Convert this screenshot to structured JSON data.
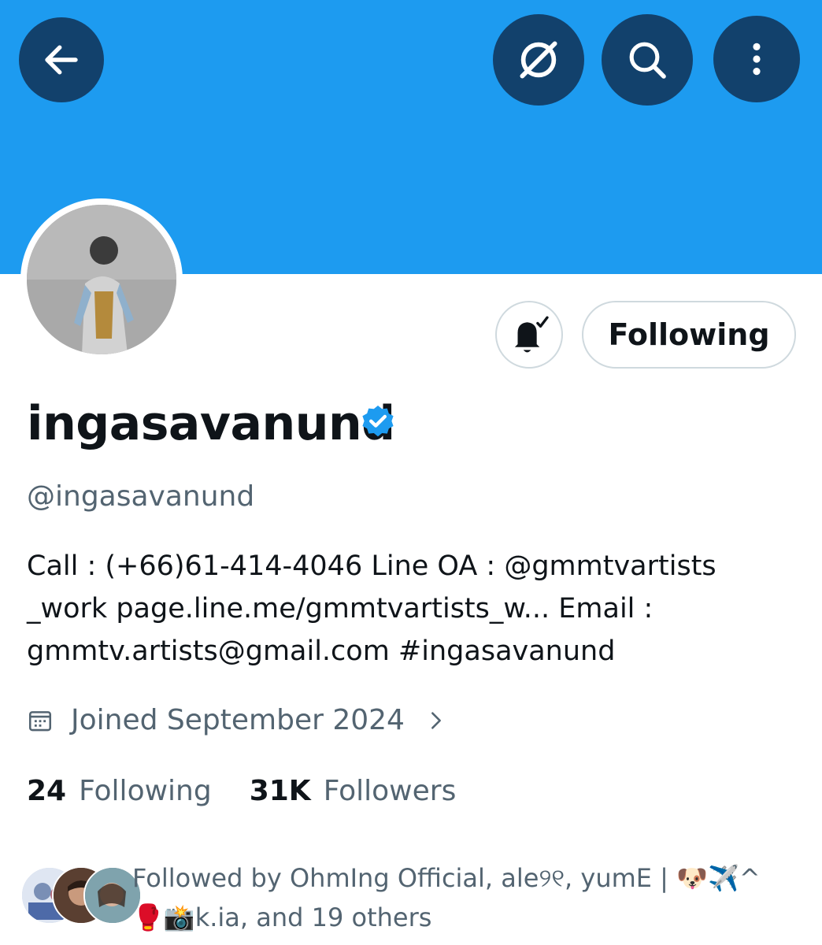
{
  "header": {
    "back_icon": "arrow-left-icon",
    "grok_icon": "grok-icon",
    "search_icon": "search-icon",
    "more_icon": "more-vertical-icon"
  },
  "profile": {
    "display_name": "ingasavanund",
    "handle": "@ingasavanund",
    "verified": true,
    "bio_lines": [
      "Call : (+66)61-414-4046  Line OA : @gmmtvartists",
      "_work page.line.me/gmmtvartists_w... Email :",
      "gmmtv.artists@gmail.com #ingasavanund"
    ],
    "joined": "Joined September 2024"
  },
  "actions": {
    "following_label": "Following",
    "bell_icon": "notification-bell-icon"
  },
  "stats": {
    "following_count": "24",
    "following_label": "Following",
    "followers_count": "31K",
    "followers_label": "Followers"
  },
  "followed_by": {
    "line1": "Followed by OhmIng Official, ale୨୧, yumE | 🐶✈️^",
    "line2": "🥊📸k.ia, and 19 others"
  },
  "colors": {
    "banner": "#1d9bf0",
    "verified": "#1d9bf0",
    "text_primary": "#0f1419",
    "text_secondary": "#536471"
  }
}
